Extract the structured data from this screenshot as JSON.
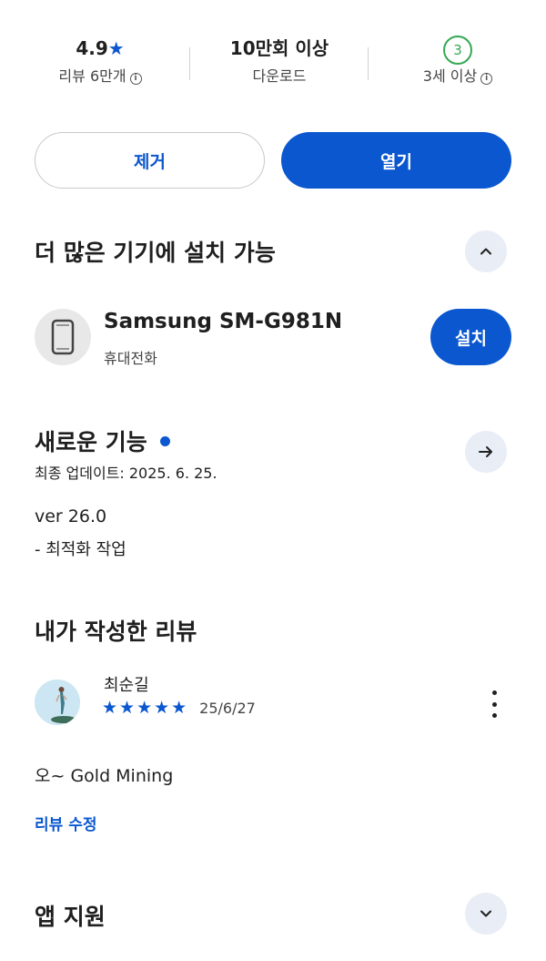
{
  "stats": [
    {
      "value": "4.9",
      "label": "리뷰 6만개"
    },
    {
      "value": "10만회 이상",
      "label": "다운로드"
    },
    {
      "value": "3",
      "label": "3세 이상"
    }
  ],
  "actions": {
    "uninstall_label": "제거",
    "open_label": "열기"
  },
  "devices": {
    "title": "더 많은 기기에 설치 가능",
    "device_name": "Samsung SM-G981N",
    "device_type": "휴대전화",
    "install_label": "설치"
  },
  "whats_new": {
    "title": "새로운 기능",
    "updated": "최종 업데이트: 2025. 6. 25.",
    "version": "ver 26.0",
    "note": "- 최적화 작업"
  },
  "my_review": {
    "title": "내가 작성한 리뷰",
    "author": "최순길",
    "rating": 5,
    "stars": "★★★★★",
    "date": "25/6/27",
    "text": "오~ Gold Mining",
    "edit_label": "리뷰 수정"
  },
  "app_support": {
    "title": "앱 지원"
  },
  "colors": {
    "accent": "#0b57d0",
    "badge_green": "#34a853",
    "icon_bg": "#e9edf6"
  }
}
